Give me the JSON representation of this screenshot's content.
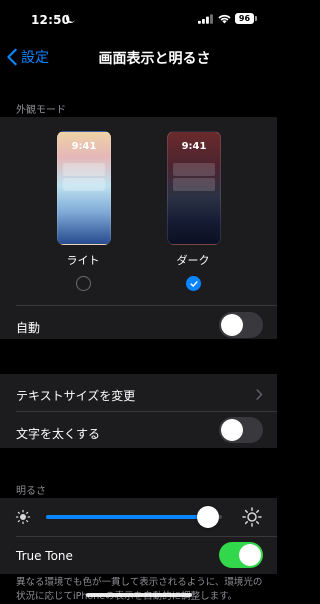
{
  "status_bar": {
    "time": "12:50",
    "battery": "96"
  },
  "nav": {
    "back_label": "設定",
    "title": "画面表示と明るさ"
  },
  "appearance": {
    "header": "外観モード",
    "preview_time": "9:41",
    "options": [
      {
        "label": "ライト",
        "selected": false
      },
      {
        "label": "ダーク",
        "selected": true
      }
    ],
    "automatic_label": "自動",
    "automatic_on": false
  },
  "text": {
    "text_size_label": "テキストサイズを変更",
    "bold_text_label": "文字を太くする",
    "bold_text_on": false
  },
  "brightness": {
    "header": "明るさ",
    "level": 0.92,
    "true_tone_label": "True Tone",
    "true_tone_on": true,
    "footnote": "異なる環境でも色が一貫して表示されるように、環境光の状況に応じてiPhoneの表示を自動的に調整します。"
  },
  "colors": {
    "accent": "#0a84ff",
    "toggle_on": "#32d74b",
    "background": "#000000",
    "cell": "#1c1c1e"
  },
  "icons": [
    "moon-icon",
    "cellular-signal-icon",
    "wifi-icon",
    "battery-icon",
    "back-chevron-icon",
    "checkmark-icon",
    "chevron-right-icon",
    "sun-small-icon",
    "sun-large-icon"
  ]
}
